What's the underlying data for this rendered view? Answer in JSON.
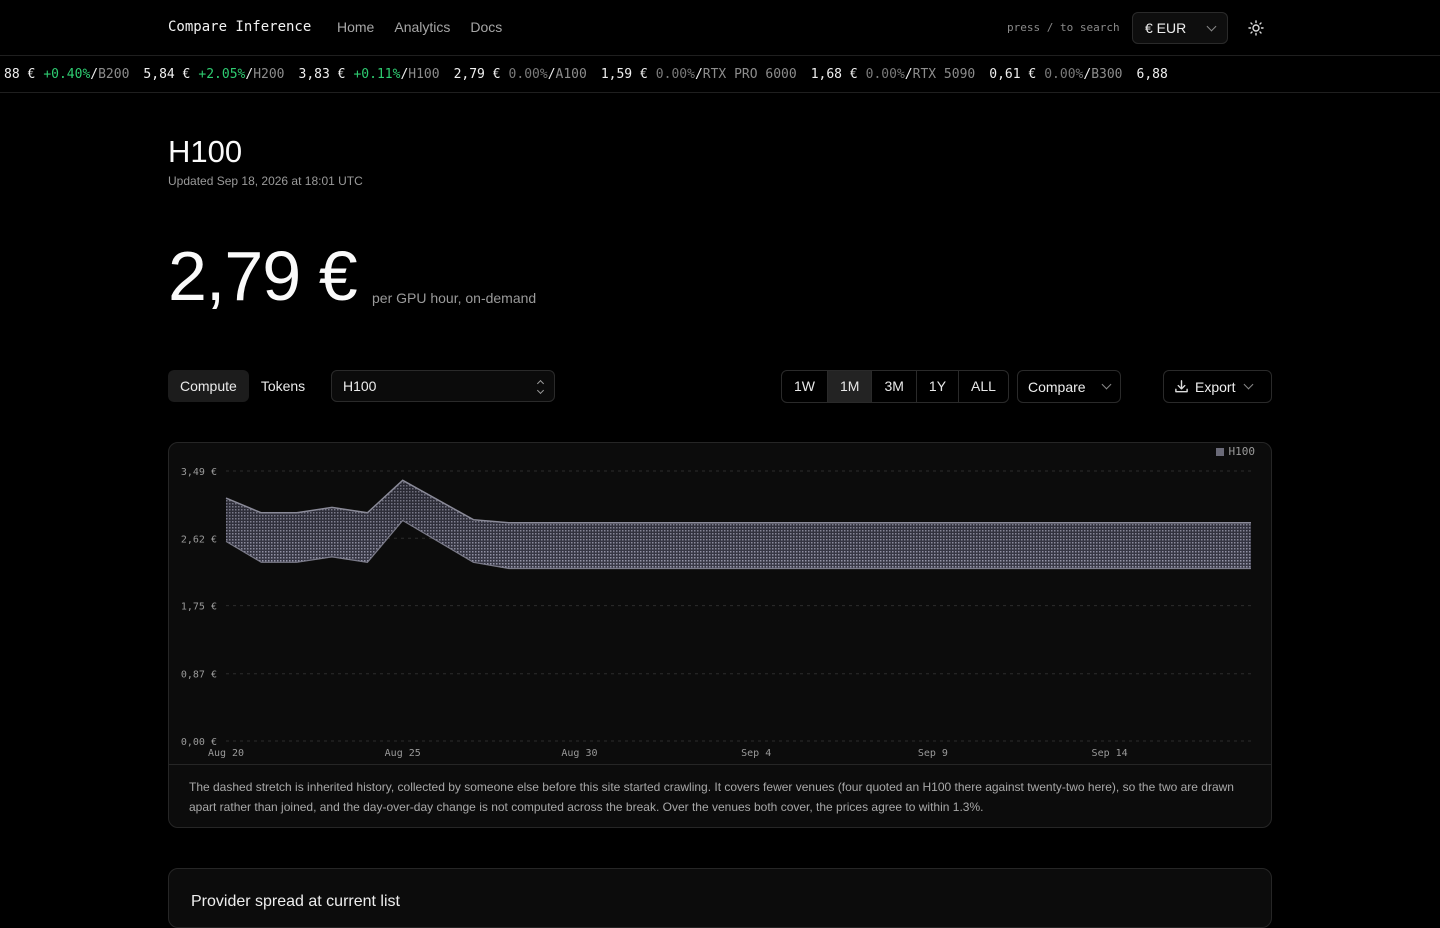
{
  "nav": {
    "brand": "Compare Inference",
    "links": [
      "Home",
      "Analytics",
      "Docs"
    ],
    "search_hint": "press / to search",
    "currency": "€ EUR"
  },
  "ticker": [
    {
      "name": "",
      "price": "88 €",
      "change": "+0.40%",
      "dir": "up"
    },
    {
      "name": "B200",
      "price": "5,84 €",
      "change": "+2.05%",
      "dir": "up"
    },
    {
      "name": "H200",
      "price": "3,83 €",
      "change": "+0.11%",
      "dir": "up"
    },
    {
      "name": "H100",
      "price": "2,79 €",
      "change": "0.00%",
      "dir": "flat"
    },
    {
      "name": "A100",
      "price": "1,59 €",
      "change": "0.00%",
      "dir": "flat"
    },
    {
      "name": "RTX PRO 6000",
      "price": "1,68 €",
      "change": "0.00%",
      "dir": "flat"
    },
    {
      "name": "RTX 5090",
      "price": "0,61 €",
      "change": "0.00%",
      "dir": "flat"
    },
    {
      "name": "B300",
      "price": "6,88",
      "change": "",
      "dir": "flat"
    }
  ],
  "page": {
    "title": "H100",
    "updated": "Updated Sep 18, 2026 at 18:01 UTC",
    "price": "2,79 €",
    "price_note": "per GPU hour, on-demand"
  },
  "controls": {
    "modes": [
      "Compute",
      "Tokens"
    ],
    "active_mode": "Compute",
    "gpu": "H100",
    "ranges": [
      "1W",
      "1M",
      "3M",
      "1Y",
      "ALL"
    ],
    "active_range": "1M",
    "compare_label": "Compare",
    "export_label": "Export"
  },
  "chart_data": {
    "type": "area",
    "series_name": "H100",
    "ylim": [
      0,
      3.49
    ],
    "yticks": [
      {
        "v": 3.49,
        "label": "3,49 €"
      },
      {
        "v": 2.62,
        "label": "2,62 €"
      },
      {
        "v": 1.75,
        "label": "1,75 €"
      },
      {
        "v": 0.87,
        "label": "0,87 €"
      },
      {
        "v": 0.0,
        "label": "0,00 €"
      }
    ],
    "xticks": [
      {
        "v": 0,
        "label": "Aug 20"
      },
      {
        "v": 5,
        "label": "Aug 25"
      },
      {
        "v": 10,
        "label": "Aug 30"
      },
      {
        "v": 15,
        "label": "Sep 4"
      },
      {
        "v": 20,
        "label": "Sep 9"
      },
      {
        "v": 25,
        "label": "Sep 14"
      }
    ],
    "x_range": [
      "Aug 20",
      "Sep 18"
    ],
    "band": [
      {
        "x": "Aug 20",
        "high": 3.14,
        "low": 2.58
      },
      {
        "x": "Aug 21",
        "high": 2.95,
        "low": 2.31
      },
      {
        "x": "Aug 22",
        "high": 2.95,
        "low": 2.31
      },
      {
        "x": "Aug 23",
        "high": 3.02,
        "low": 2.38
      },
      {
        "x": "Aug 24",
        "high": 2.95,
        "low": 2.31
      },
      {
        "x": "Aug 25",
        "high": 3.37,
        "low": 2.85
      },
      {
        "x": "Aug 27",
        "high": 2.86,
        "low": 2.31
      },
      {
        "x": "Aug 28",
        "high": 2.82,
        "low": 2.23
      },
      {
        "x": "Sep 18",
        "high": 2.82,
        "low": 2.23
      }
    ],
    "legend_position": "top-right"
  },
  "footnote": "The dashed stretch is inherited history, collected by someone else before this site started crawling. It covers fewer venues (four quoted an H100 there against twenty-two here), so the two are drawn apart rather than joined, and the day-over-day change is not computed across the break. Over the venues both cover, the prices agree to within 1.3%.",
  "next_section_title": "Provider spread at current list"
}
